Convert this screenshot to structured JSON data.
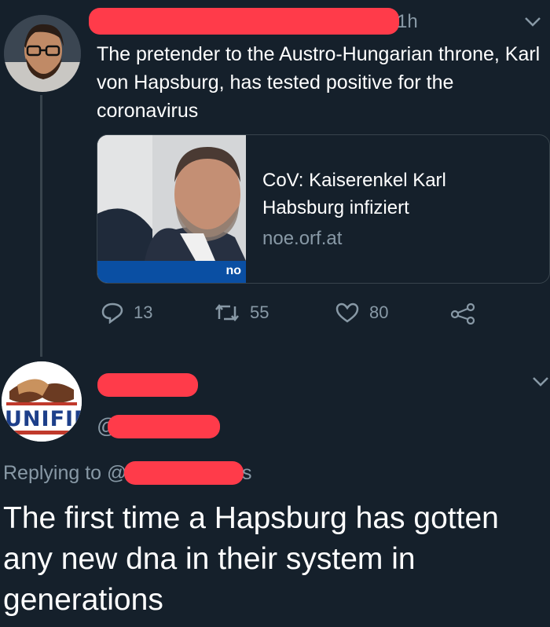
{
  "tweet": {
    "time": "1h",
    "text": "The pretender to the Austro-Hungarian throne, Karl von Hapsburg, has tested positive for the coronavirus",
    "card": {
      "title": "CoV: Kaiserenkel Karl Habsburg infiziert",
      "domain": "noe.orf.at",
      "image_caption": "no"
    },
    "actions": {
      "reply_count": "13",
      "retweet_count": "55",
      "like_count": "80"
    }
  },
  "reply": {
    "avatar_logo_text": "UNIFIED",
    "replying_to_label": "Replying to @",
    "handle_suffix": "s",
    "text": "The first time a Hapsburg has gotten any new dna in their system in generations",
    "handle_prefix": "@"
  },
  "icons": [
    "reply-icon",
    "retweet-icon",
    "heart-icon",
    "share-icon",
    "chevron-down-icon"
  ]
}
